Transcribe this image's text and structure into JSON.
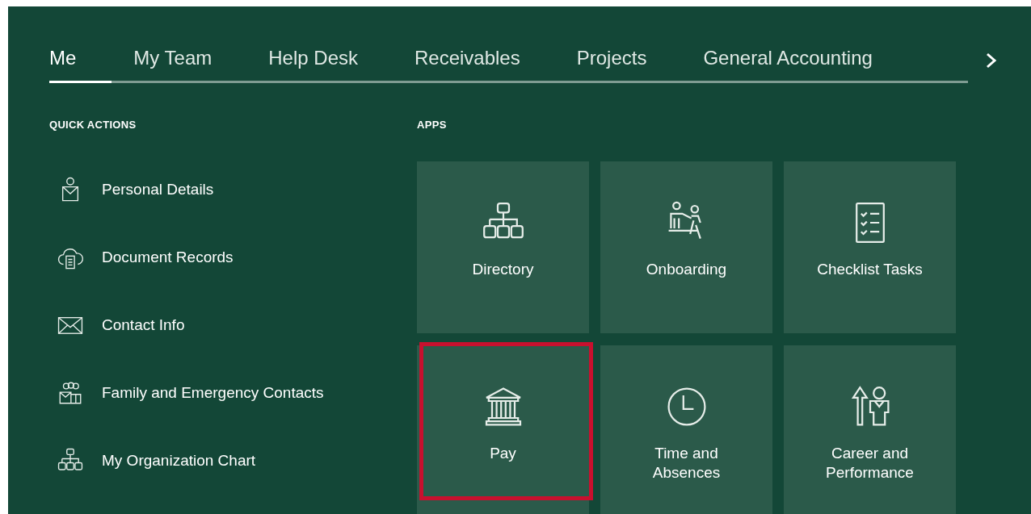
{
  "tabs": [
    {
      "label": "Me",
      "selected": true
    },
    {
      "label": "My Team",
      "selected": false
    },
    {
      "label": "Help Desk",
      "selected": false
    },
    {
      "label": "Receivables",
      "selected": false
    },
    {
      "label": "Projects",
      "selected": false
    },
    {
      "label": "General Accounting",
      "selected": false
    }
  ],
  "quick_actions": {
    "title": "QUICK ACTIONS",
    "items": [
      {
        "label": "Personal Details"
      },
      {
        "label": "Document Records"
      },
      {
        "label": "Contact Info"
      },
      {
        "label": "Family and Emergency Contacts"
      },
      {
        "label": "My Organization Chart"
      }
    ]
  },
  "apps": {
    "title": "APPS",
    "tiles": [
      {
        "label": "Directory",
        "highlighted": false
      },
      {
        "label": "Onboarding",
        "highlighted": false
      },
      {
        "label": "Checklist Tasks",
        "highlighted": false
      },
      {
        "label": "Pay",
        "highlighted": true
      },
      {
        "label": "Time and Absences",
        "highlighted": false
      },
      {
        "label": "Career and Performance",
        "highlighted": false
      }
    ]
  }
}
